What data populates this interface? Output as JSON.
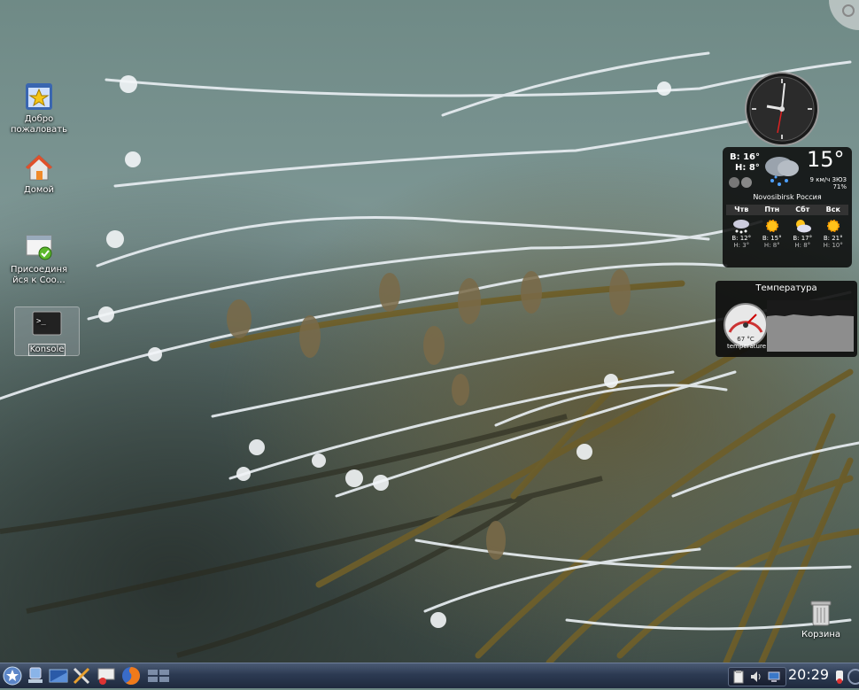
{
  "desktop": {
    "icons": [
      {
        "id": "welcome",
        "label": "Добро пожаловать",
        "icon": "welcome-star-icon"
      },
      {
        "id": "home",
        "label": "Домой",
        "icon": "home-folder-icon"
      },
      {
        "id": "join",
        "label": "Присоединя йся к Соо…",
        "icon": "community-join-icon"
      },
      {
        "id": "konsole",
        "label": "Konsole",
        "icon": "terminal-icon"
      }
    ],
    "trash_label": "Корзина"
  },
  "weather": {
    "today_high": "В: 16°",
    "today_low": "Н: 8°",
    "current_temp": "15°",
    "wind": "9 км/ч ЗЮЗ",
    "humidity": "71%",
    "location": "Novosibirsk Россия",
    "days": [
      {
        "name": "Чтв",
        "high": "В: 12°",
        "low": "Н: 3°",
        "icon": "snow-cloud-icon"
      },
      {
        "name": "Птн",
        "high": "В: 15°",
        "low": "Н: 8°",
        "icon": "sun-icon"
      },
      {
        "name": "Сбт",
        "high": "В: 17°",
        "low": "Н: 8°",
        "icon": "sun-cloud-icon"
      },
      {
        "name": "Вск",
        "high": "В: 21°",
        "low": "Н: 10°",
        "icon": "sun-icon"
      }
    ]
  },
  "temperature_widget": {
    "title": "Температура",
    "value": "67 °C",
    "sensor": "temperature"
  },
  "panel": {
    "launchers": [
      "kickoff-menu-icon",
      "network-icon",
      "desktop-show-icon",
      "tools-icon",
      "system-icon",
      "firefox-icon",
      "pager-icon"
    ],
    "clock": "20:29"
  }
}
